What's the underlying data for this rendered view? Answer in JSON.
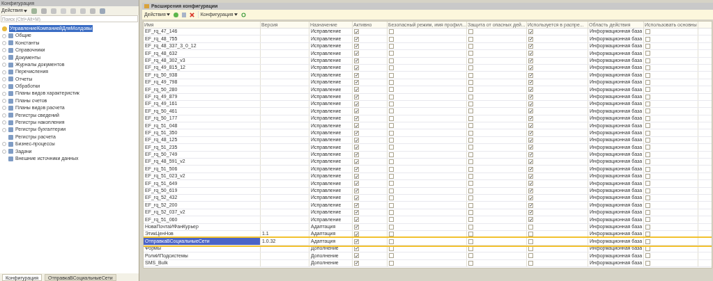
{
  "left_panel": {
    "title": "Конфигурация",
    "toolbar": {
      "actions": "Действия"
    },
    "search": {
      "placeholder": "Поиск (Ctrl+Alt+M)"
    },
    "tree": {
      "root": {
        "label": "УправлениеКомпаниейДляМолдовы",
        "selected": true
      },
      "items": [
        {
          "label": "Общие",
          "expandable": true
        },
        {
          "label": "Константы",
          "expandable": true
        },
        {
          "label": "Справочники",
          "expandable": true
        },
        {
          "label": "Документы",
          "expandable": true
        },
        {
          "label": "Журналы документов",
          "expandable": true
        },
        {
          "label": "Перечисления",
          "expandable": true
        },
        {
          "label": "Отчеты",
          "expandable": true
        },
        {
          "label": "Обработки",
          "expandable": true
        },
        {
          "label": "Планы видов характеристик",
          "expandable": true
        },
        {
          "label": "Планы счетов",
          "expandable": true
        },
        {
          "label": "Планы видов расчета",
          "expandable": true
        },
        {
          "label": "Регистры сведений",
          "expandable": true
        },
        {
          "label": "Регистры накопления",
          "expandable": true
        },
        {
          "label": "Регистры бухгалтерии",
          "expandable": true
        },
        {
          "label": "Регистры расчета",
          "expandable": false
        },
        {
          "label": "Бизнес-процессы",
          "expandable": true
        },
        {
          "label": "Задачи",
          "expandable": true
        },
        {
          "label": "Внешние источники данных",
          "expandable": false
        }
      ]
    },
    "tabs": [
      {
        "label": "Конфигурация",
        "selected": true
      },
      {
        "label": "ОтправкаВСоциальныеСети",
        "selected": false
      }
    ]
  },
  "window": {
    "title": "Расширения конфигурации",
    "toolbar": {
      "actions": "Действия",
      "configuration": "Конфигурация"
    },
    "table": {
      "columns": [
        "Имя",
        "Версия",
        "Назначение",
        "Активно",
        "Безопасный режим, имя профил...",
        "Защита от опасных дей...",
        "Используется в распре...",
        "Область действия",
        "Использовать основны"
      ],
      "rows": [
        {
          "name": "EF_rq_47_146",
          "purpose": "Исправление",
          "active": true,
          "safe_mode": false,
          "protection": false,
          "distributed": true,
          "scope": "Информационная база",
          "use_main": false,
          "selected": false
        },
        {
          "name": "EF_rq_48_755",
          "purpose": "Исправление",
          "active": true,
          "safe_mode": false,
          "protection": false,
          "distributed": true,
          "scope": "Информационная база",
          "use_main": false,
          "selected": false
        },
        {
          "name": "EF_rq_48_337_3_0_12",
          "purpose": "Исправление",
          "active": true,
          "safe_mode": false,
          "protection": false,
          "distributed": true,
          "scope": "Информационная база",
          "use_main": false,
          "selected": false
        },
        {
          "name": "EF_rq_48_632",
          "purpose": "Исправление",
          "active": true,
          "safe_mode": false,
          "protection": false,
          "distributed": true,
          "scope": "Информационная база",
          "use_main": false,
          "selected": false
        },
        {
          "name": "EF_rq_48_302_v3",
          "purpose": "Исправление",
          "active": true,
          "safe_mode": false,
          "protection": false,
          "distributed": true,
          "scope": "Информационная база",
          "use_main": false,
          "selected": false
        },
        {
          "name": "EF_rq_49_815_12",
          "purpose": "Исправление",
          "active": true,
          "safe_mode": false,
          "protection": false,
          "distributed": true,
          "scope": "Информационная база",
          "use_main": false,
          "selected": false
        },
        {
          "name": "EF_rq_50_938",
          "purpose": "Исправление",
          "active": true,
          "safe_mode": false,
          "protection": false,
          "distributed": true,
          "scope": "Информационная база",
          "use_main": false,
          "selected": false
        },
        {
          "name": "EF_rq_49_798",
          "purpose": "Исправление",
          "active": true,
          "safe_mode": false,
          "protection": false,
          "distributed": true,
          "scope": "Информационная база",
          "use_main": false,
          "selected": false
        },
        {
          "name": "EF_rq_50_280",
          "purpose": "Исправление",
          "active": true,
          "safe_mode": false,
          "protection": false,
          "distributed": true,
          "scope": "Информационная база",
          "use_main": false,
          "selected": false
        },
        {
          "name": "EF_rq_49_879",
          "purpose": "Исправление",
          "active": true,
          "safe_mode": false,
          "protection": false,
          "distributed": true,
          "scope": "Информационная база",
          "use_main": false,
          "selected": false
        },
        {
          "name": "EF_rq_49_161",
          "purpose": "Исправление",
          "active": true,
          "safe_mode": false,
          "protection": false,
          "distributed": true,
          "scope": "Информационная база",
          "use_main": false,
          "selected": false
        },
        {
          "name": "EF_rq_50_461",
          "purpose": "Исправление",
          "active": true,
          "safe_mode": false,
          "protection": false,
          "distributed": true,
          "scope": "Информационная база",
          "use_main": false,
          "selected": false
        },
        {
          "name": "EF_rq_50_177",
          "purpose": "Исправление",
          "active": true,
          "safe_mode": false,
          "protection": false,
          "distributed": true,
          "scope": "Информационная база",
          "use_main": false,
          "selected": false
        },
        {
          "name": "EF_rq_51_048",
          "purpose": "Исправление",
          "active": true,
          "safe_mode": false,
          "protection": false,
          "distributed": true,
          "scope": "Информационная база",
          "use_main": false,
          "selected": false
        },
        {
          "name": "EF_rq_51_350",
          "purpose": "Исправление",
          "active": true,
          "safe_mode": false,
          "protection": false,
          "distributed": true,
          "scope": "Информационная база",
          "use_main": false,
          "selected": false
        },
        {
          "name": "EF_rq_48_125",
          "purpose": "Исправление",
          "active": true,
          "safe_mode": false,
          "protection": false,
          "distributed": true,
          "scope": "Информационная база",
          "use_main": false,
          "selected": false
        },
        {
          "name": "EF_rq_51_235",
          "purpose": "Исправление",
          "active": true,
          "safe_mode": false,
          "protection": false,
          "distributed": true,
          "scope": "Информационная база",
          "use_main": false,
          "selected": false
        },
        {
          "name": "EF_rq_50_749",
          "purpose": "Исправление",
          "active": true,
          "safe_mode": false,
          "protection": false,
          "distributed": true,
          "scope": "Информационная база",
          "use_main": false,
          "selected": false
        },
        {
          "name": "EF_rq_48_591_v2",
          "purpose": "Исправление",
          "active": true,
          "safe_mode": false,
          "protection": false,
          "distributed": true,
          "scope": "Информационная база",
          "use_main": false,
          "selected": false
        },
        {
          "name": "EF_rq_51_506",
          "purpose": "Исправление",
          "active": true,
          "safe_mode": false,
          "protection": false,
          "distributed": true,
          "scope": "Информационная база",
          "use_main": false,
          "selected": false
        },
        {
          "name": "EF_rq_51_023_v2",
          "purpose": "Исправление",
          "active": true,
          "safe_mode": false,
          "protection": false,
          "distributed": true,
          "scope": "Информационная база",
          "use_main": false,
          "selected": false
        },
        {
          "name": "EF_rq_51_649",
          "purpose": "Исправление",
          "active": true,
          "safe_mode": false,
          "protection": false,
          "distributed": true,
          "scope": "Информационная база",
          "use_main": false,
          "selected": false
        },
        {
          "name": "EF_rq_50_619",
          "purpose": "Исправление",
          "active": true,
          "safe_mode": false,
          "protection": false,
          "distributed": true,
          "scope": "Информационная база",
          "use_main": false,
          "selected": false
        },
        {
          "name": "EF_rq_52_432",
          "purpose": "Исправление",
          "active": true,
          "safe_mode": false,
          "protection": false,
          "distributed": true,
          "scope": "Информационная база",
          "use_main": false,
          "selected": false
        },
        {
          "name": "EF_rq_52_200",
          "purpose": "Исправление",
          "active": true,
          "safe_mode": false,
          "protection": false,
          "distributed": true,
          "scope": "Информационная база",
          "use_main": false,
          "selected": false
        },
        {
          "name": "EF_rq_52_037_v2",
          "purpose": "Исправление",
          "active": true,
          "safe_mode": false,
          "protection": false,
          "distributed": true,
          "scope": "Информационная база",
          "use_main": false,
          "selected": false
        },
        {
          "name": "EF_rq_51_060",
          "purpose": "Исправление",
          "active": true,
          "safe_mode": false,
          "protection": false,
          "distributed": true,
          "scope": "Информационная база",
          "use_main": false,
          "selected": false
        },
        {
          "name": "НоваПочтаИФанКурьер",
          "purpose": "Адаптация",
          "active": true,
          "safe_mode": false,
          "protection": false,
          "distributed": false,
          "scope": "Информационная база",
          "use_main": false,
          "selected": false
        },
        {
          "name": "ЭтикЦенНов",
          "version": "1.1",
          "purpose": "Адаптация",
          "active": true,
          "safe_mode": false,
          "protection": false,
          "distributed": false,
          "scope": "Информационная база",
          "use_main": false,
          "selected": false
        },
        {
          "name": "ОтправкаВСоциальныеСети",
          "version": "1.0.32",
          "purpose": "Адаптация",
          "active": true,
          "safe_mode": false,
          "protection": false,
          "distributed": false,
          "scope": "Информационная база",
          "use_main": false,
          "selected": true
        },
        {
          "name": "Формы",
          "purpose": "Дополнение",
          "active": true,
          "safe_mode": false,
          "protection": false,
          "distributed": false,
          "scope": "Информационная база",
          "use_main": false,
          "selected": false
        },
        {
          "name": "РолиИПодсистемы",
          "purpose": "Дополнение",
          "active": true,
          "safe_mode": false,
          "protection": false,
          "distributed": false,
          "scope": "Информационная база",
          "use_main": false,
          "selected": false
        },
        {
          "name": "SMS_Bulk",
          "purpose": "Дополнение",
          "active": true,
          "safe_mode": false,
          "protection": false,
          "distributed": false,
          "scope": "Информационная база",
          "use_main": false,
          "selected": false
        }
      ]
    }
  }
}
